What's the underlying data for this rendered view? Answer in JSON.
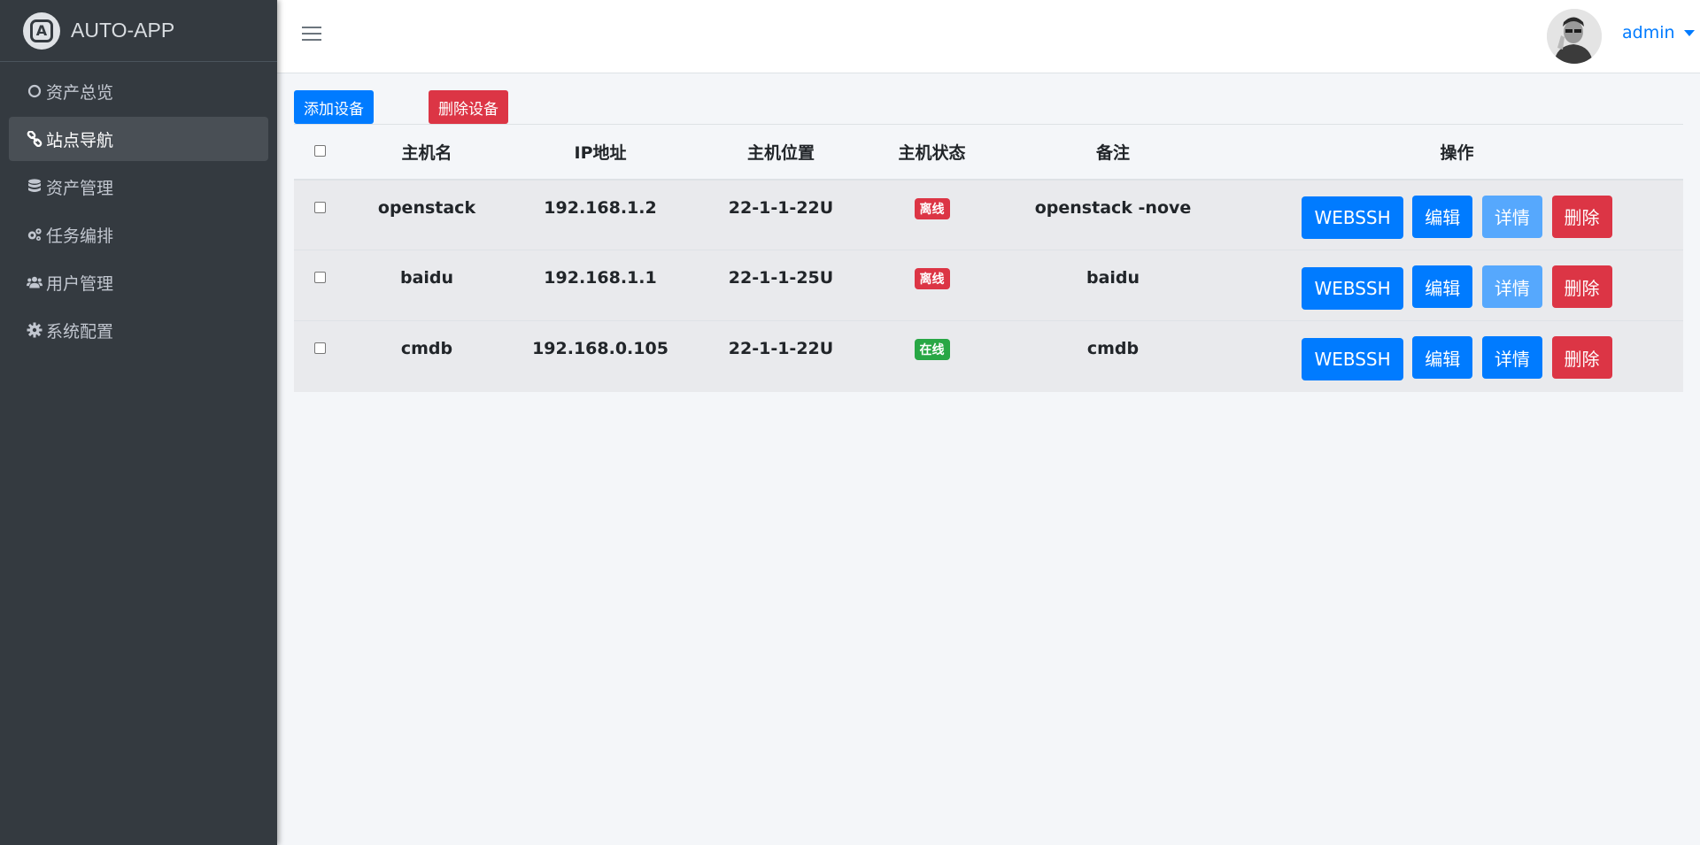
{
  "brand": {
    "title": "AUTO-APP",
    "logo_letter": "A"
  },
  "sidebar": {
    "items": [
      {
        "label": "资产总览",
        "icon": "circle-icon",
        "active": false
      },
      {
        "label": "站点导航",
        "icon": "link-icon",
        "active": true
      },
      {
        "label": "资产管理",
        "icon": "database-icon",
        "active": false
      },
      {
        "label": "任务编排",
        "icon": "cogs-icon",
        "active": false
      },
      {
        "label": "用户管理",
        "icon": "users-icon",
        "active": false
      },
      {
        "label": "系统配置",
        "icon": "gear-icon",
        "active": false
      }
    ]
  },
  "header": {
    "username": "admin"
  },
  "toolbar": {
    "add_label": "添加设备",
    "delete_label": "删除设备"
  },
  "table": {
    "columns": [
      "主机名",
      "IP地址",
      "主机位置",
      "主机状态",
      "备注",
      "操作"
    ],
    "rows": [
      {
        "hostname": "openstack",
        "ip": "192.168.1.2",
        "location": "22-1-1-22U",
        "status": "离线",
        "status_color": "#dc3545",
        "note": "openstack -nove"
      },
      {
        "hostname": "baidu",
        "ip": "192.168.1.1",
        "location": "22-1-1-25U",
        "status": "离线",
        "status_color": "#dc3545",
        "note": "baidu"
      },
      {
        "hostname": "cmdb",
        "ip": "192.168.0.105",
        "location": "22-1-1-22U",
        "status": "在线",
        "status_color": "#28a745",
        "note": "cmdb"
      }
    ],
    "actions": {
      "webssh": "WEBSSH",
      "edit": "编辑",
      "detail": "详情",
      "delete": "删除"
    }
  },
  "colors": {
    "primary": "#007bff",
    "danger": "#dc3545",
    "success": "#28a745",
    "sidebar_bg": "#343a40"
  }
}
